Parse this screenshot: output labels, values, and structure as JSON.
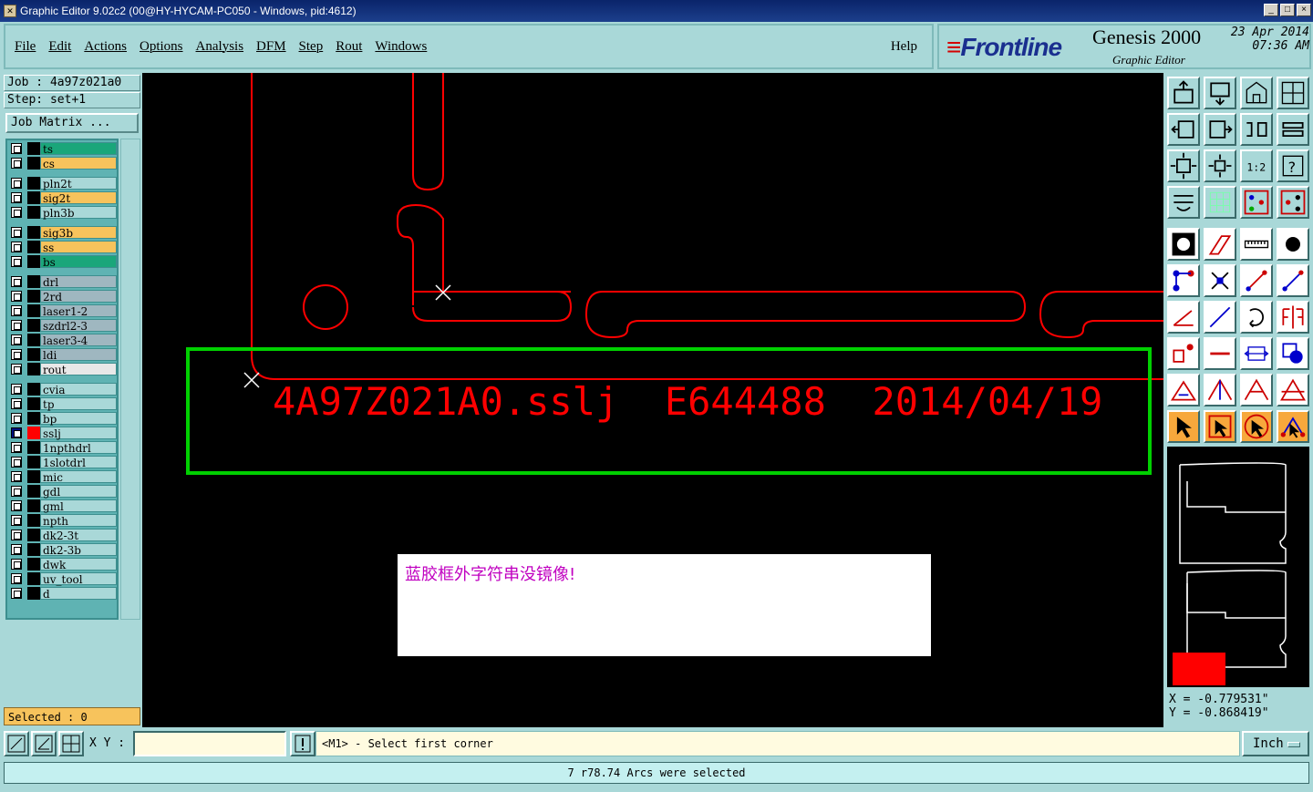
{
  "window": {
    "title": "Graphic Editor 9.02c2 (00@HY-HYCAM-PC050 - Windows, pid:4612)",
    "controls": [
      "_",
      "□",
      "×"
    ]
  },
  "menu": {
    "items": [
      "File",
      "Edit",
      "Actions",
      "Options",
      "Analysis",
      "DFM",
      "Step",
      "Rout",
      "Windows"
    ],
    "help": "Help"
  },
  "brand": {
    "logo": "Frontline",
    "product": "Genesis 2000",
    "module": "Graphic Editor",
    "date": "23 Apr 2014",
    "time": "07:36 AM"
  },
  "left": {
    "job": "Job : 4a97z021a0",
    "step": "Step: set+1",
    "job_matrix": "Job Matrix ...",
    "selected": "Selected : 0",
    "layers": [
      {
        "name": "ts",
        "color": "#1aa67a"
      },
      {
        "name": "cs",
        "color": "#f7c35c"
      },
      {
        "name": "pln2t",
        "color": "#a9d8d8"
      },
      {
        "name": "sig2t",
        "color": "#f7c35c"
      },
      {
        "name": "pln3b",
        "color": "#a9d8d8"
      },
      {
        "name": "sig3b",
        "color": "#f7c35c"
      },
      {
        "name": "ss",
        "color": "#f7c35c"
      },
      {
        "name": "bs",
        "color": "#1aa67a"
      },
      {
        "name": "drl",
        "color": "#9fb7c0"
      },
      {
        "name": "2rd",
        "color": "#9fb7c0"
      },
      {
        "name": "laser1-2",
        "color": "#9fb7c0"
      },
      {
        "name": "szdrl2-3",
        "color": "#9fb7c0"
      },
      {
        "name": "laser3-4",
        "color": "#9fb7c0"
      },
      {
        "name": "ldi",
        "color": "#9fb7c0"
      },
      {
        "name": "rout",
        "color": "#e8e8e8"
      },
      {
        "name": "cvia",
        "color": "#a9d8d8"
      },
      {
        "name": "tp",
        "color": "#a9d8d8"
      },
      {
        "name": "bp",
        "color": "#a9d8d8"
      },
      {
        "name": "sslj",
        "color": "#a9d8d8"
      },
      {
        "name": "1npthdrl",
        "color": "#a9d8d8"
      },
      {
        "name": "1slotdrl",
        "color": "#a9d8d8"
      },
      {
        "name": "mic",
        "color": "#a9d8d8"
      },
      {
        "name": "gdl",
        "color": "#a9d8d8"
      },
      {
        "name": "gml",
        "color": "#a9d8d8"
      },
      {
        "name": "npth",
        "color": "#a9d8d8"
      },
      {
        "name": "dk2-3t",
        "color": "#a9d8d8"
      },
      {
        "name": "dk2-3b",
        "color": "#a9d8d8"
      },
      {
        "name": "dwk",
        "color": "#a9d8d8"
      },
      {
        "name": "uv_tool",
        "color": "#a9d8d8"
      },
      {
        "name": "d",
        "color": "#a9d8d8"
      }
    ],
    "active_layer": "sslj"
  },
  "canvas": {
    "text_string": "4A97Z021A0.sslj  E644488  2014/04/19",
    "message": "蓝胶框外字符串没镜像!",
    "colors": {
      "background": "#000000",
      "features": "#ff0000",
      "highlight_box": "#00d000",
      "message": "#c000c0"
    }
  },
  "toolbar_icons": [
    "zoom-home-icon",
    "zoom-out-icon",
    "home-icon",
    "window-icon",
    "pan-left-icon",
    "pan-right-icon",
    "undo-view-icon",
    "redo-view-icon",
    "fit-icon",
    "zoom-step-icon",
    "scale-1to2-icon",
    "help-icon",
    "snap-icon",
    "grid-icon",
    "layers-top-icon",
    "layers-bottom-icon",
    "feature-icon",
    "shape-icon",
    "measure-icon",
    "pad-icon",
    "net-icon",
    "cross-icon",
    "line-icon",
    "arrow-line-icon",
    "angle-icon",
    "diagonal-icon",
    "rotate-icon",
    "mirror-icon",
    "move-icon",
    "dash-icon",
    "dim-icon",
    "component-icon",
    "triangle-icon",
    "triangle-up-icon",
    "triangle-a-icon",
    "triangle-b-icon",
    "select-arrow-icon",
    "select-box-icon",
    "select-circle-icon",
    "select-net-icon"
  ],
  "coords": {
    "x": "X = -0.779531\"",
    "y": "Y = -0.868419\""
  },
  "bottom": {
    "xy_label": "X Y :",
    "xy_value": "",
    "prompt": "<M1> - Select first corner",
    "unit": "Inch",
    "status": "7 r78.74 Arcs were selected"
  }
}
